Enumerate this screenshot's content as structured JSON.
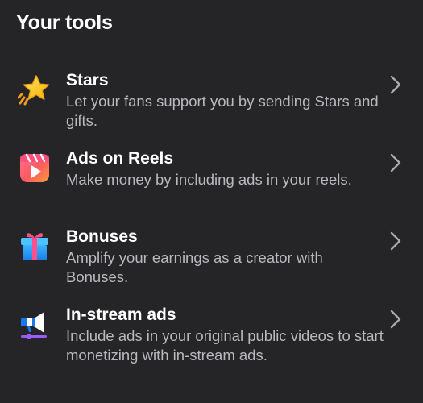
{
  "section": {
    "title": "Your tools"
  },
  "tools": [
    {
      "icon": "star-icon",
      "title": "Stars",
      "description": "Let your fans support you by sending Stars and gifts."
    },
    {
      "icon": "reels-play-icon",
      "title": "Ads on Reels",
      "description": "Make money by including ads in your reels."
    },
    {
      "icon": "gift-icon",
      "title": "Bonuses",
      "description": "Amplify your earnings as a creator with Bonuses."
    },
    {
      "icon": "megaphone-icon",
      "title": "In-stream ads",
      "description": "Include ads in your original public videos to start monetizing with in-stream ads."
    }
  ],
  "colors": {
    "background": "#252527",
    "title_text": "#ffffff",
    "description_text": "#b8b8bd",
    "chevron": "#a9a9ae"
  }
}
